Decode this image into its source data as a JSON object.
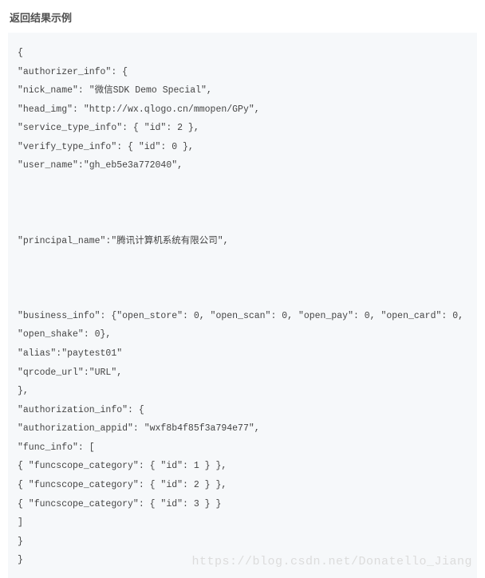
{
  "heading": "返回结果示例",
  "watermark": "https://blog.csdn.net/Donatello_Jiang",
  "code_lines": [
    "{",
    "\"authorizer_info\": {",
    "\"nick_name\": \"微信SDK Demo Special\",",
    "\"head_img\": \"http://wx.qlogo.cn/mmopen/GPy\",",
    "\"service_type_info\": { \"id\": 2 },",
    "\"verify_type_info\": { \"id\": 0 },",
    "\"user_name\":\"gh_eb5e3a772040\",",
    "",
    "",
    "",
    "\"principal_name\":\"腾讯计算机系统有限公司\",",
    "",
    "",
    "",
    "\"business_info\": {\"open_store\": 0, \"open_scan\": 0, \"open_pay\": 0, \"open_card\": 0, \"open_shake\": 0},",
    "\"alias\":\"paytest01\"",
    "\"qrcode_url\":\"URL\",",
    "},",
    "\"authorization_info\": {",
    "\"authorization_appid\": \"wxf8b4f85f3a794e77\",",
    "\"func_info\": [",
    "{ \"funcscope_category\": { \"id\": 1 } },",
    "{ \"funcscope_category\": { \"id\": 2 } },",
    "{ \"funcscope_category\": { \"id\": 3 } }",
    "]",
    "}",
    "}"
  ]
}
